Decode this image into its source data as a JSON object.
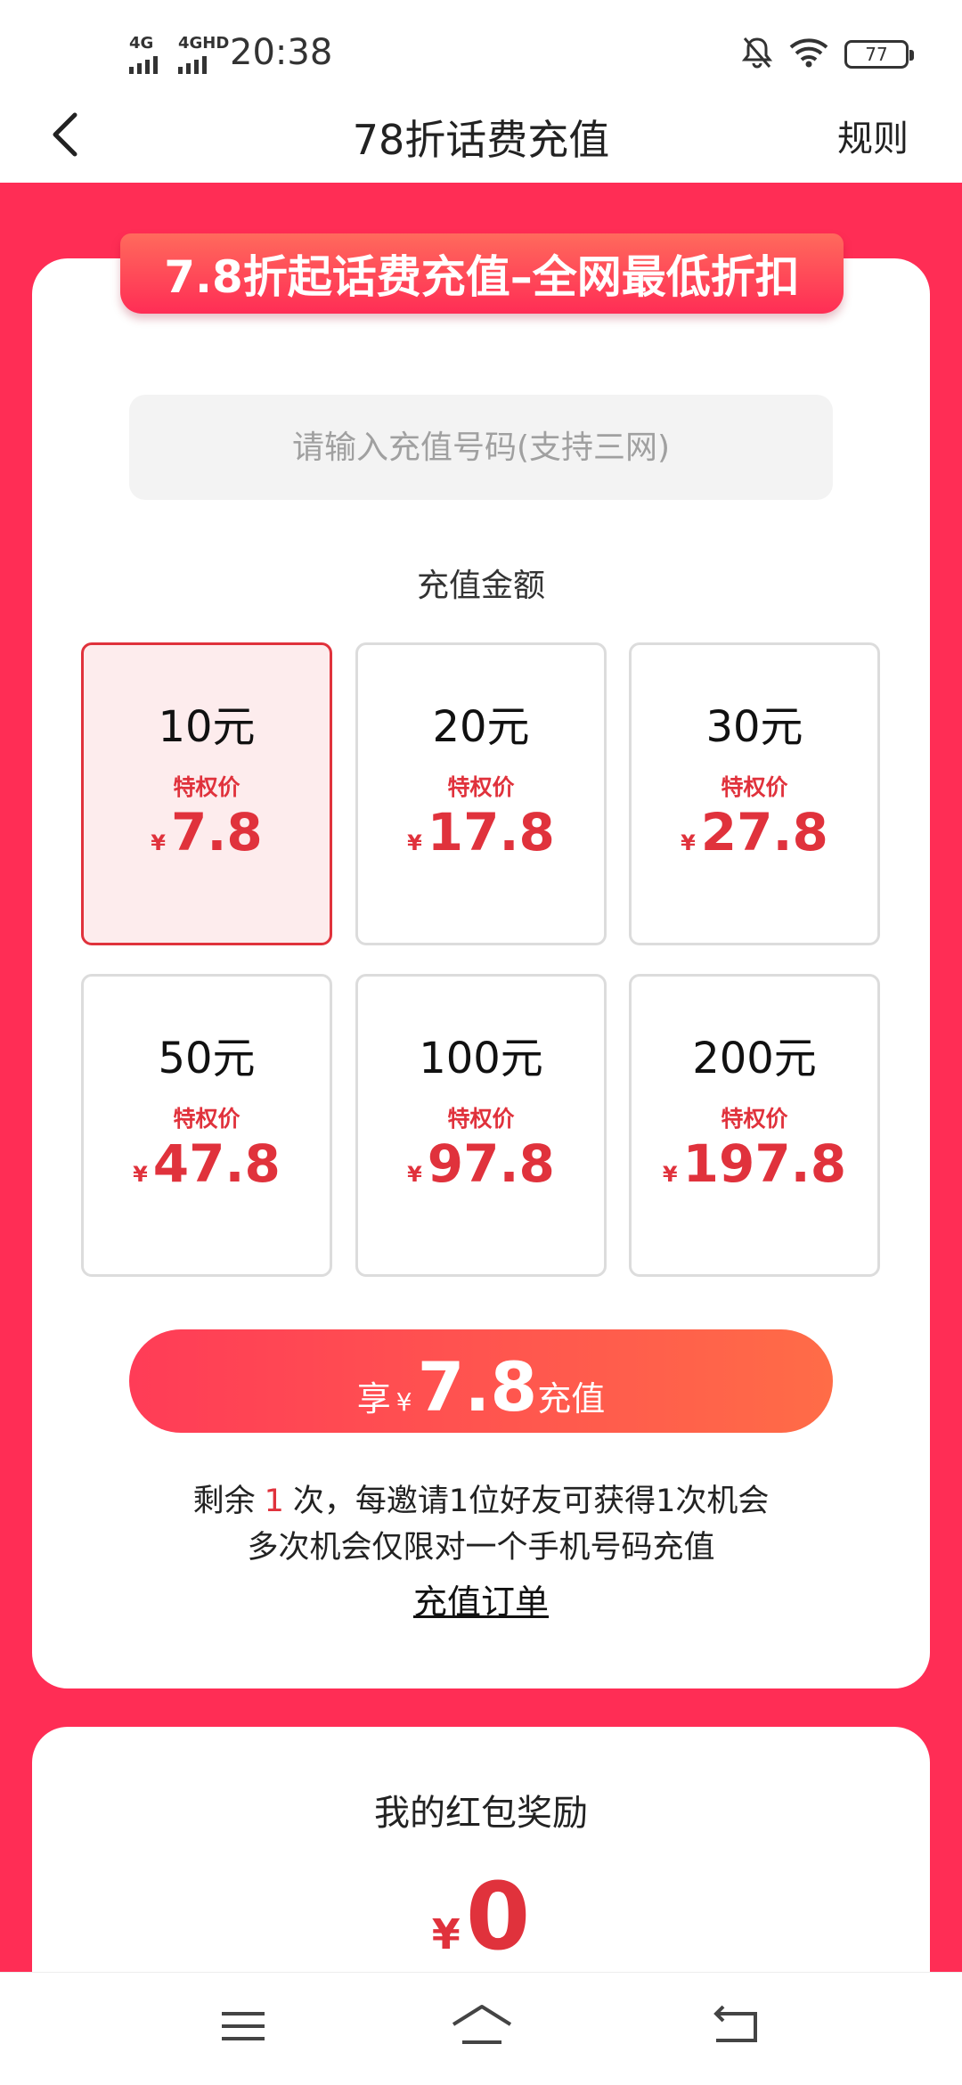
{
  "status_bar": {
    "time": "20:38",
    "sim1": "4G",
    "sim2": "4GHD",
    "battery": "77",
    "icons": [
      "bell-off-icon",
      "wifi-icon",
      "battery-icon"
    ]
  },
  "header": {
    "back_icon": "back-chevron-icon",
    "title": "78折话费充值",
    "rules_label": "规则"
  },
  "banner": {
    "text": "7.8折起话费充值–全网最低折扣"
  },
  "phone_input": {
    "value": "",
    "placeholder": "请输入充值号码(支持三网)"
  },
  "amount_section_title": "充值金额",
  "options": [
    {
      "face": "10元",
      "tag": "特权价",
      "currency": "¥",
      "price": "7.8",
      "selected": true
    },
    {
      "face": "20元",
      "tag": "特权价",
      "currency": "¥",
      "price": "17.8",
      "selected": false
    },
    {
      "face": "30元",
      "tag": "特权价",
      "currency": "¥",
      "price": "27.8",
      "selected": false
    },
    {
      "face": "50元",
      "tag": "特权价",
      "currency": "¥",
      "price": "47.8",
      "selected": false
    },
    {
      "face": "100元",
      "tag": "特权价",
      "currency": "¥",
      "price": "97.8",
      "selected": false
    },
    {
      "face": "200元",
      "tag": "特权价",
      "currency": "¥",
      "price": "197.8",
      "selected": false
    }
  ],
  "cta": {
    "prefix": "享",
    "currency": "¥",
    "amount": "7.8",
    "suffix": "充值"
  },
  "remaining": {
    "before": "剩余",
    "count": "1",
    "after": "次，每邀请1位好友可获得1次机会"
  },
  "limit_note": "多次机会仅限对一个手机号码充值",
  "orders_link": "充值订单",
  "reward": {
    "title": "我的红包奖励",
    "currency": "¥",
    "amount": "0"
  },
  "system_nav": [
    "menu-icon",
    "home-icon",
    "return-icon"
  ],
  "colors": {
    "background": "#ff2d55",
    "accent_red": "#e0323c",
    "selected_fill": "#fdeced",
    "cta_start": "#ff3c57",
    "cta_end": "#ff6c47"
  }
}
